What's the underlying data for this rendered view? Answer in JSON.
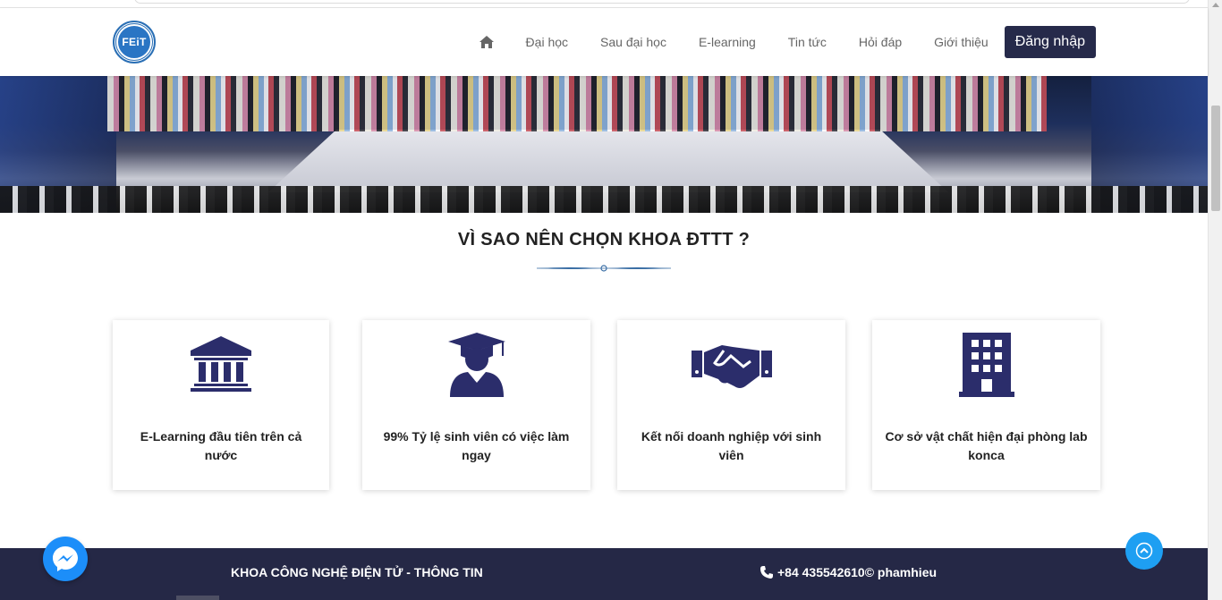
{
  "header": {
    "logo_text": "FEiT",
    "nav": [
      {
        "label": "Đại học"
      },
      {
        "label": "Sau đại học"
      },
      {
        "label": "E-learning"
      },
      {
        "label": "Tin tức"
      },
      {
        "label": "Hỏi đáp"
      },
      {
        "label": "Giới thiệu"
      }
    ],
    "login_label": "Đăng nhập"
  },
  "section": {
    "title": "VÌ SAO NÊN CHỌN KHOA ĐTTT ?"
  },
  "cards": [
    {
      "icon": "university-icon",
      "text": "E-Learning đầu tiên trên cả nước"
    },
    {
      "icon": "graduate-icon",
      "text": "99% Tỷ lệ sinh viên có việc làm ngay"
    },
    {
      "icon": "handshake-icon",
      "text": "Kết nối doanh nghiệp với sinh viên"
    },
    {
      "icon": "building-icon",
      "text": "Cơ sở vật chất hiện đại phòng lab konca"
    }
  ],
  "footer": {
    "name": "KHOA CÔNG NGHỆ ĐIỆN TỬ - THÔNG TIN",
    "contact": "+84 435542610© phamhieu"
  },
  "colors": {
    "navy": "#262a4a",
    "icon": "#2b2d6b",
    "footer_bg": "#252846",
    "messenger": "#1c8ef9",
    "to_top": "#1e9ff2"
  }
}
